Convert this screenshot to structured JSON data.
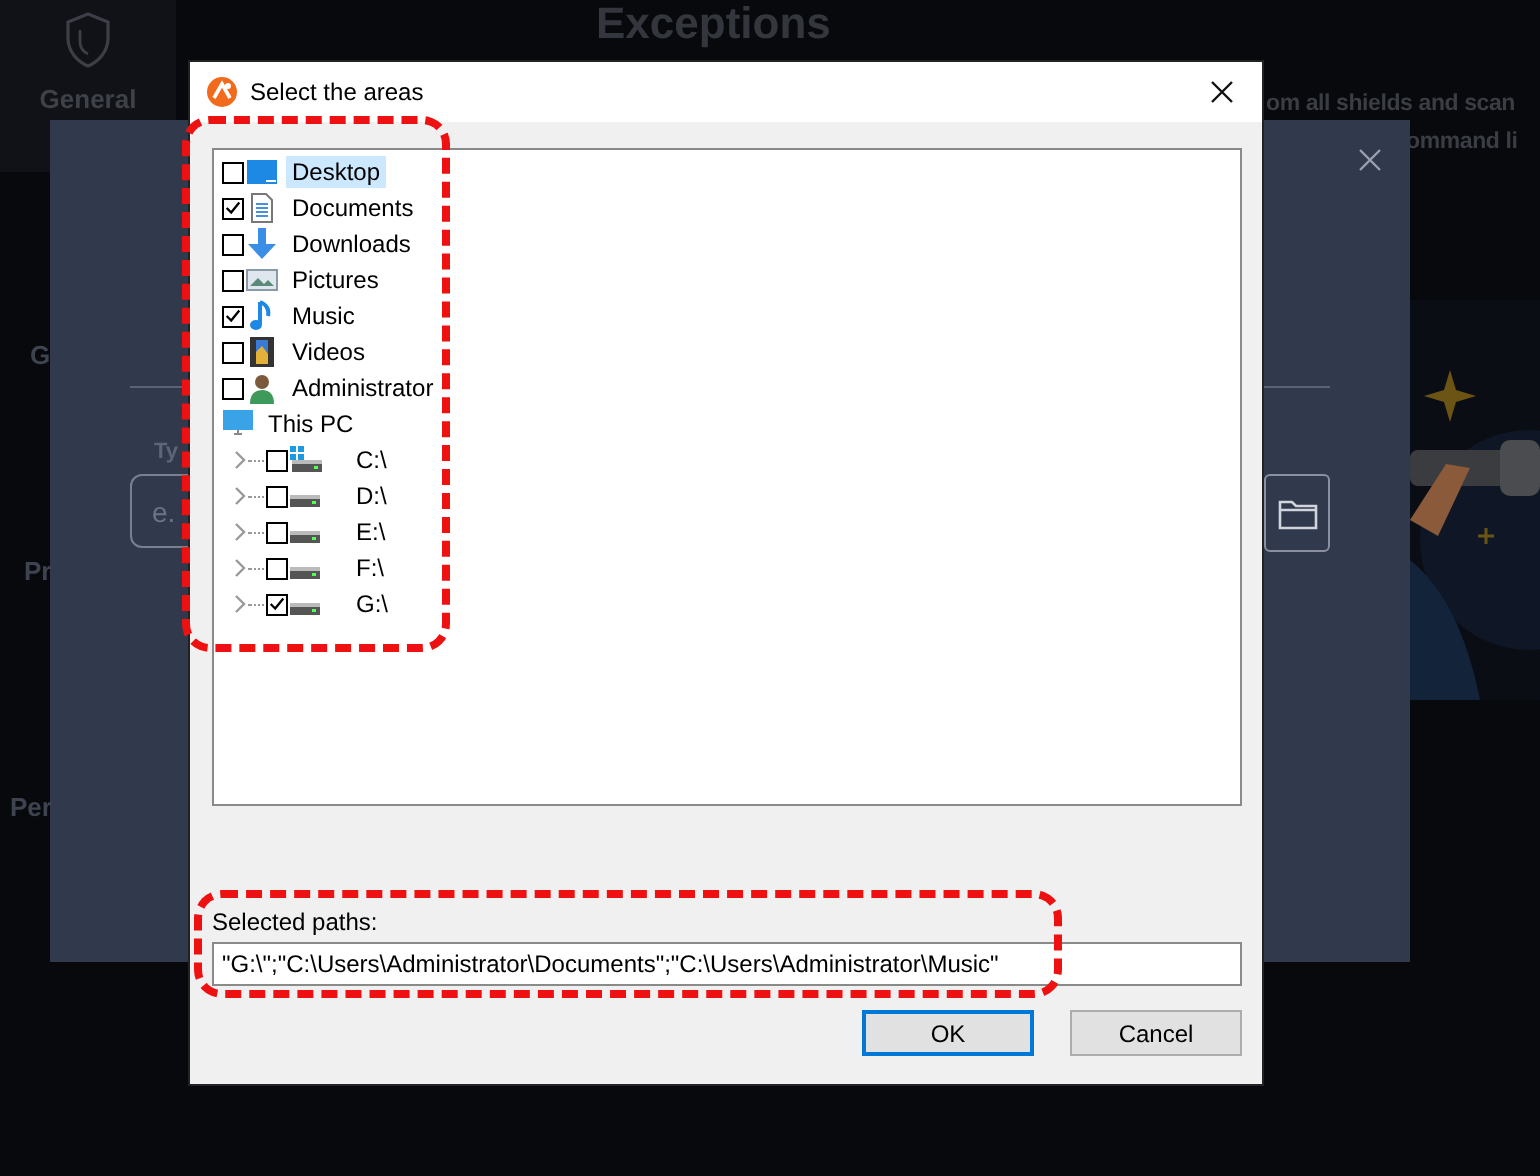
{
  "background": {
    "title": "Exceptions",
    "sidebar_item": "General",
    "description_lines": [
      "om all shields and scan",
      "ommand li"
    ],
    "panel": {
      "labels": [
        {
          "kind": "g",
          "text": "G"
        },
        {
          "kind": "typ",
          "text": "Ty"
        },
        {
          "kind": "pr",
          "text": "Pr"
        },
        {
          "kind": "per",
          "text": "Per"
        }
      ],
      "input_placeholder": "e."
    }
  },
  "dialog": {
    "title": "Select the areas",
    "tree": [
      {
        "label": "Desktop",
        "kind": "desktop",
        "checked": false,
        "selected": true
      },
      {
        "label": "Documents",
        "kind": "documents",
        "checked": true,
        "selected": false
      },
      {
        "label": "Downloads",
        "kind": "downloads",
        "checked": false,
        "selected": false
      },
      {
        "label": "Pictures",
        "kind": "pictures",
        "checked": false,
        "selected": false
      },
      {
        "label": "Music",
        "kind": "music",
        "checked": true,
        "selected": false
      },
      {
        "label": "Videos",
        "kind": "videos",
        "checked": false,
        "selected": false
      },
      {
        "label": "Administrator",
        "kind": "user",
        "checked": false,
        "selected": false
      },
      {
        "label": "This PC",
        "kind": "pc",
        "selected": false,
        "children": [
          {
            "label": "C:\\",
            "kind": "system-drive",
            "checked": false,
            "selected": false
          },
          {
            "label": "D:\\",
            "kind": "drive",
            "checked": false,
            "selected": false
          },
          {
            "label": "E:\\",
            "kind": "drive",
            "checked": false,
            "selected": false
          },
          {
            "label": "F:\\",
            "kind": "drive",
            "checked": false,
            "selected": false
          },
          {
            "label": "G:\\",
            "kind": "drive",
            "checked": true,
            "selected": false
          }
        ]
      }
    ],
    "selected_paths_label": "Selected paths:",
    "selected_paths_value": "\"G:\\\";\"C:\\Users\\Administrator\\Documents\";\"C:\\Users\\Administrator\\Music\"",
    "buttons": [
      {
        "label": "OK",
        "default": true
      },
      {
        "label": "Cancel",
        "default": false
      }
    ]
  }
}
